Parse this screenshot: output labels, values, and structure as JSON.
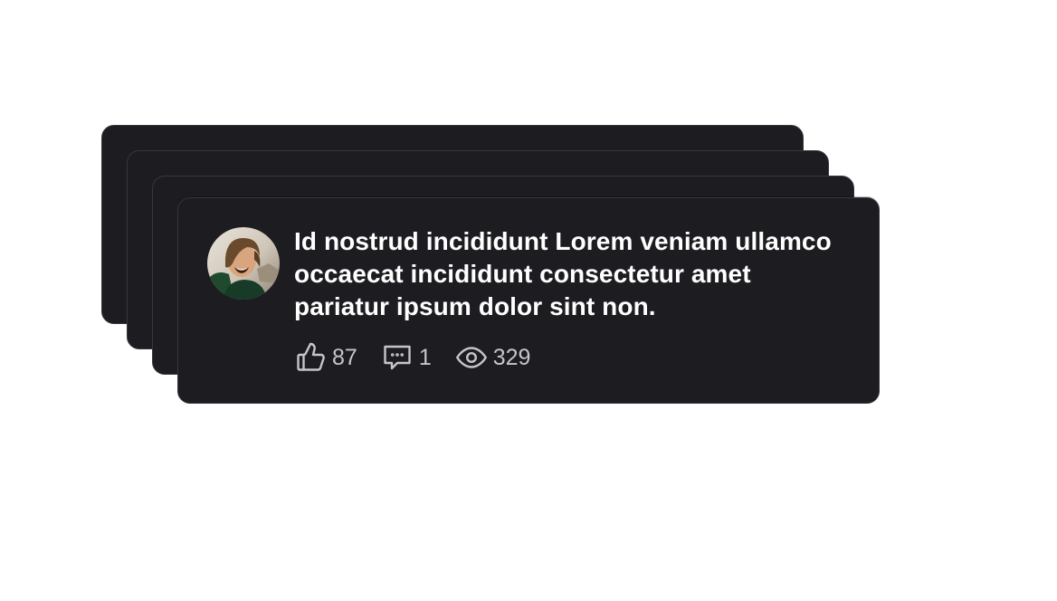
{
  "post": {
    "text": "Id nostrud incididunt Lorem veniam ullamco occaecat incididunt consectetur amet pariatur ipsum dolor sint non.",
    "avatar_icon": "user-photo-avatar"
  },
  "stats": {
    "likes": {
      "icon": "thumbs-up-icon",
      "count": "87"
    },
    "comments": {
      "icon": "comment-icon",
      "count": "1"
    },
    "views": {
      "icon": "eye-icon",
      "count": "329"
    }
  },
  "colors": {
    "card_background": "#1d1c20",
    "card_border": "#38373d",
    "text_primary": "#ffffff",
    "text_muted": "#c6c5cc",
    "page_background": "#ffffff"
  }
}
